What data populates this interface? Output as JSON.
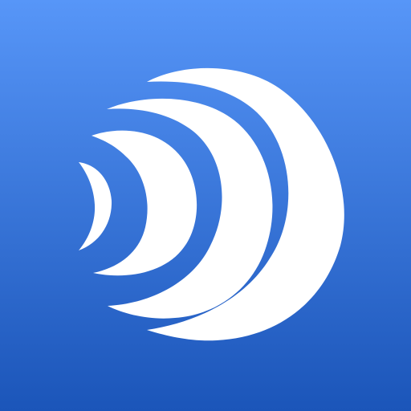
{
  "icon": {
    "name": "concentric-sound-wave-logo",
    "colors": {
      "background_top": "#5796F8",
      "background_bottom": "#1B55B9",
      "waves": "#FFFFFF"
    }
  }
}
